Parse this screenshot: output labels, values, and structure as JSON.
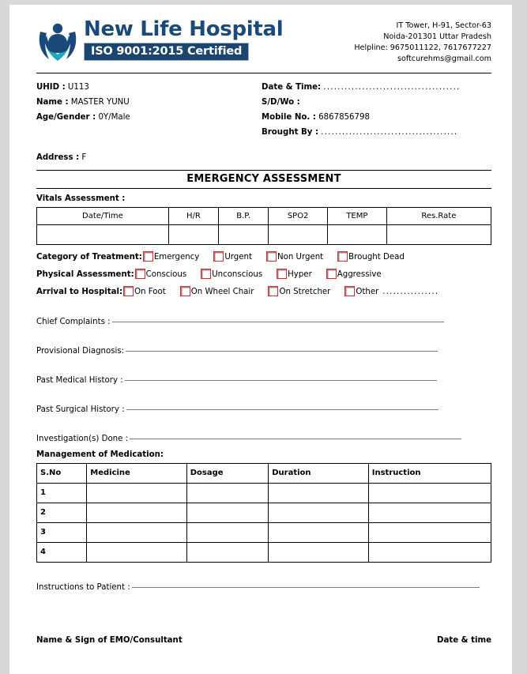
{
  "hospital": {
    "name": "New Life Hospital",
    "iso_badge": "ISO 9001:2015 Certified",
    "logo_icon": "person-with-raised-arms-logo",
    "brand_navy": "#1b4a7a",
    "brand_teal": "#1fa6b8"
  },
  "contact": {
    "line1": "IT Tower, H-91, Sector-63",
    "line2": "Noida-201301 Uttar Pradesh",
    "line3": "Helpline: 9675011122, 7617677227",
    "line4": "softcurehms@gmail.com"
  },
  "patient": {
    "uhid_label": "UHID :",
    "uhid_value": "U113",
    "name_label": "Name :",
    "name_value": "MASTER YUNU",
    "age_gender_label": "Age/Gender :",
    "age_gender_value": "0Y/Male",
    "address_label": "Address :",
    "address_value": "F",
    "datetime_label": "Date & Time:",
    "datetime_value": ".......................................",
    "sdwo_label": "S/D/Wo :",
    "sdwo_value": "",
    "mobile_label": "Mobile No. :",
    "mobile_value": "6867856798",
    "brought_by_label": "Brought By :",
    "brought_by_value": "......................................."
  },
  "form": {
    "title": "EMERGENCY ASSESSMENT",
    "vitals_label": "Vitals Assessment :",
    "management_label": "Management of Medication:"
  },
  "vitals_table": {
    "headers": [
      "Date/Time",
      "H/R",
      "B.P.",
      "SPO2",
      "TEMP",
      "Res.Rate"
    ],
    "rows": [
      [
        "",
        "",
        "",
        "",
        "",
        ""
      ]
    ]
  },
  "checkboxes": {
    "category": {
      "label": "Category of Treatment:",
      "options": [
        "Emergency",
        "Urgent",
        "Non Urgent",
        "Brought Dead"
      ]
    },
    "physical": {
      "label": "Physical Assessment:",
      "options": [
        "Conscious",
        "Unconscious",
        "Hyper",
        "Aggressive"
      ]
    },
    "arrival": {
      "label": "Arrival to Hospital:",
      "options": [
        "On Foot",
        "On Wheel Chair",
        "On Stretcher",
        "Other"
      ],
      "other_dots": "................",
      "box_border_color": "#e8242a"
    }
  },
  "fields": {
    "chief_complaints": "Chief Complaints :",
    "provisional_diagnosis": "Provisional Diagnosis:",
    "past_medical_history": "Past Medical History :",
    "past_surgical_history": "Past Surgical History : ",
    "investigations_done": "Investigation(s) Done :",
    "instructions_to_patient": "Instructions to Patient :"
  },
  "medication_table": {
    "headers": [
      "S.No",
      "Medicine",
      "Dosage",
      "Duration",
      "Instruction"
    ],
    "rows": [
      {
        "sno": "1",
        "medicine": "",
        "dosage": "",
        "duration": "",
        "instruction": ""
      },
      {
        "sno": "2",
        "medicine": "",
        "dosage": "",
        "duration": "",
        "instruction": ""
      },
      {
        "sno": "3",
        "medicine": "",
        "dosage": "",
        "duration": "",
        "instruction": ""
      },
      {
        "sno": "4",
        "medicine": "",
        "dosage": "",
        "duration": "",
        "instruction": ""
      }
    ]
  },
  "footer": {
    "left": "Name & Sign of EMO/Consultant",
    "right": "Date & time"
  }
}
